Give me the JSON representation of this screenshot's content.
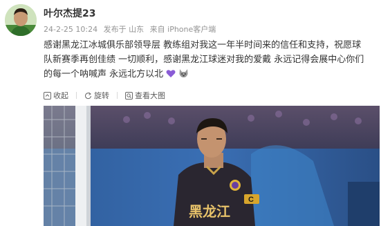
{
  "post": {
    "author": "叶尔杰提23",
    "time": "24-2-25 10:24",
    "via": "发布于 山东",
    "source": "来自 iPhone客户端",
    "text_line1": "感谢黑龙江冰城俱乐部领导层 教练组对我这一年半时间来的信任和支持，祝愿球",
    "text_line2": "队新赛季再创佳绩 一切顺利，感谢黑龙江球迷对我的爱戴 永远记得会展中心你们",
    "text_line3": "的每一个呐喊声 永远北方以北"
  },
  "actions": {
    "collapse": "收起",
    "rotate": "旋转",
    "view_large": "查看大图"
  },
  "photo": {
    "jersey_text": "黑龙江",
    "captain_band": "C"
  },
  "colors": {
    "author": "#333333",
    "meta": "#939393",
    "heart": "#8a5cd6"
  }
}
